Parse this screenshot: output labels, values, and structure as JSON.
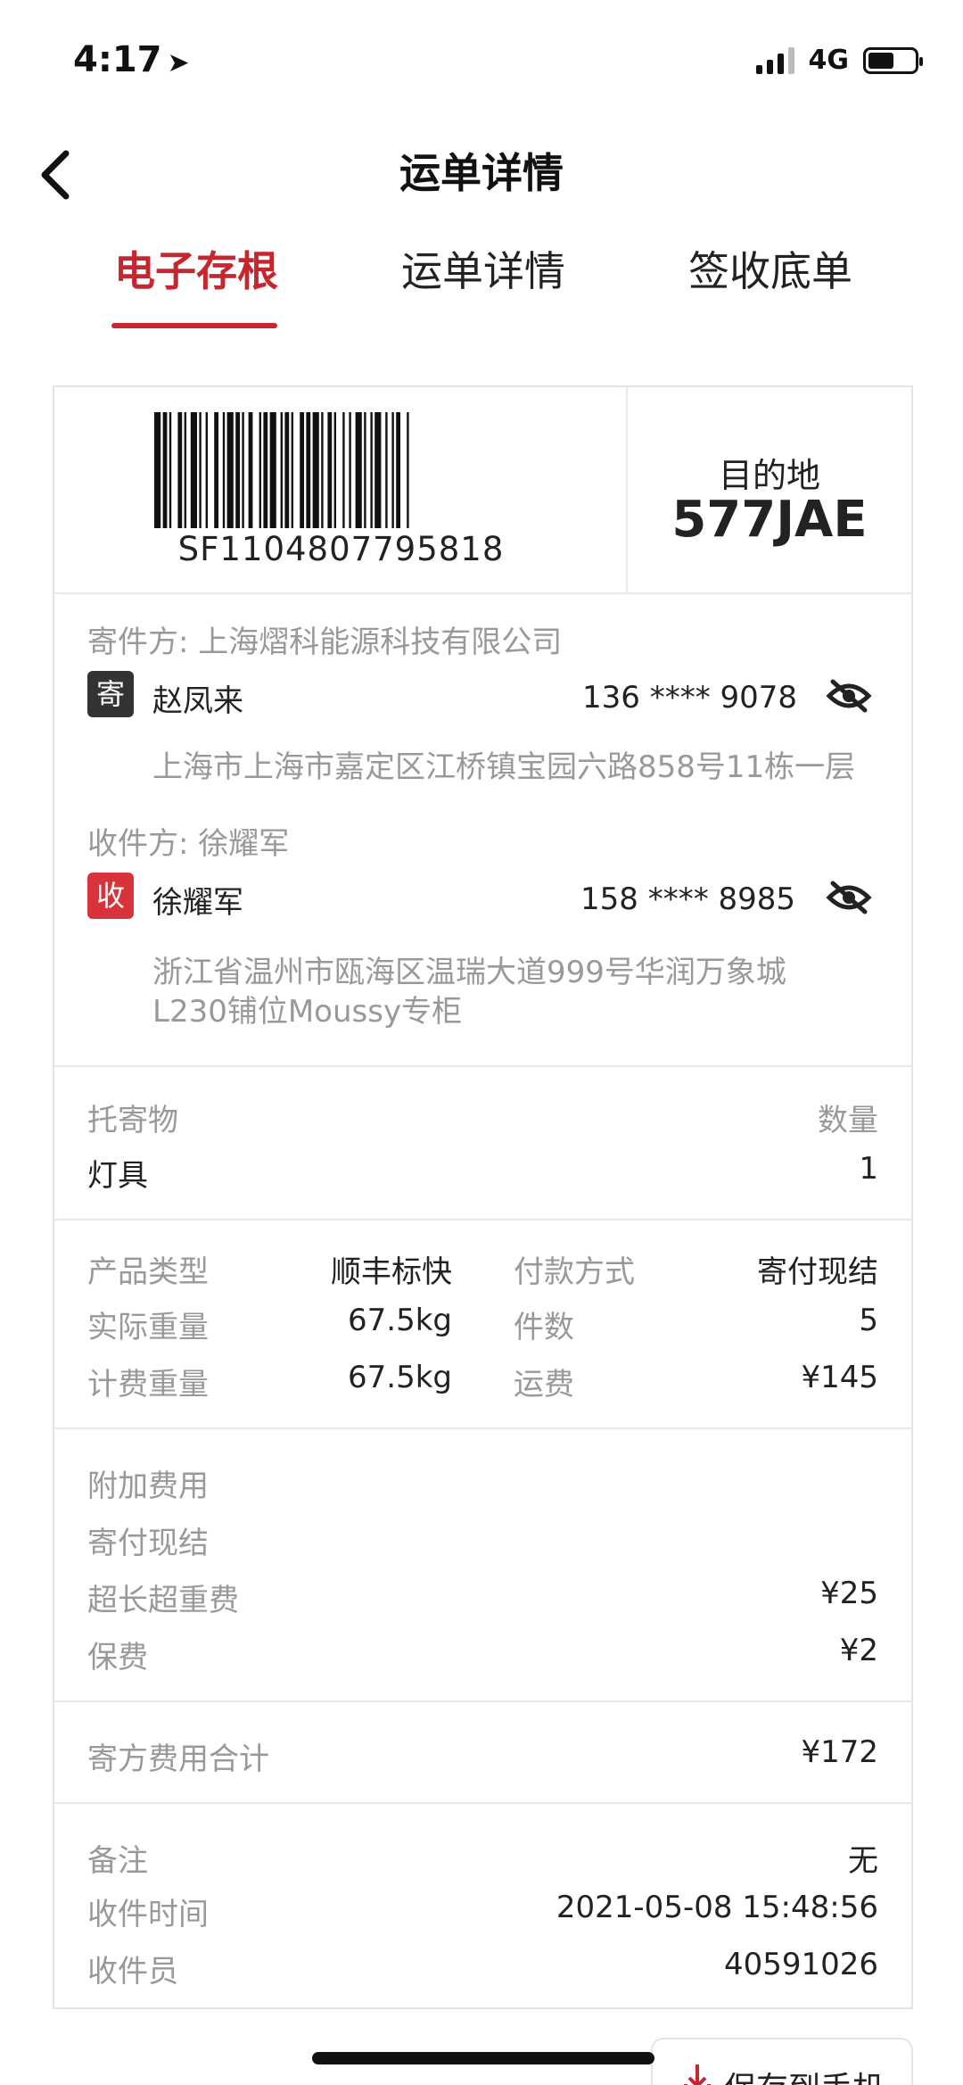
{
  "status": {
    "time": "4:17",
    "network": "4G"
  },
  "nav": {
    "title": "运单详情"
  },
  "tabs": [
    {
      "label": "电子存根"
    },
    {
      "label": "运单详情"
    },
    {
      "label": "签收底单"
    }
  ],
  "waybill": {
    "barcode_number": "SF1104807795818",
    "destination_label": "目的地",
    "destination_code": "577JAE"
  },
  "sender": {
    "header": "寄件方: 上海熠科能源科技有限公司",
    "badge": "寄",
    "name": "赵凤来",
    "phone": "136 **** 9078",
    "address": "上海市上海市嘉定区江桥镇宝园六路858号11栋一层"
  },
  "receiver": {
    "header": "收件方: 徐耀军",
    "badge": "收",
    "name": "徐耀军",
    "phone": "158 **** 8985",
    "address_line1": "浙江省温州市瓯海区温瑞大道999号华润万象城",
    "address_line2": "L230铺位Moussy专柜"
  },
  "goods": {
    "item_label": "托寄物",
    "qty_label": "数量",
    "item_value": "灯具",
    "qty_value": "1"
  },
  "details": {
    "product_type_label": "产品类型",
    "product_type": "顺丰标快",
    "payment_label": "付款方式",
    "payment": "寄付现结",
    "actual_weight_label": "实际重量",
    "actual_weight": "67.5kg",
    "pieces_label": "件数",
    "pieces": "5",
    "billed_weight_label": "计费重量",
    "billed_weight": "67.5kg",
    "freight_label": "运费",
    "freight": "¥145"
  },
  "extra_fees": {
    "title": "附加费用",
    "subtitle": "寄付现结",
    "items": [
      {
        "label": "超长超重费",
        "value": "¥25"
      },
      {
        "label": "保费",
        "value": "¥2"
      }
    ]
  },
  "total": {
    "label": "寄方费用合计",
    "value": "¥172"
  },
  "misc": {
    "remark_label": "备注",
    "remark": "无",
    "pickup_time_label": "收件时间",
    "pickup_time": "2021-05-08 15:48:56",
    "courier_label": "收件员",
    "courier": "40591026"
  },
  "save_button": {
    "label": "保存到手机"
  },
  "colors": {
    "accent": "#c7262f",
    "sender_badge": "#333333",
    "receiver_badge": "#d8333a"
  },
  "icons": [
    "back-arrow-icon",
    "location-arrow-icon",
    "signal-icon",
    "battery-icon",
    "eye-off-icon",
    "download-icon"
  ]
}
